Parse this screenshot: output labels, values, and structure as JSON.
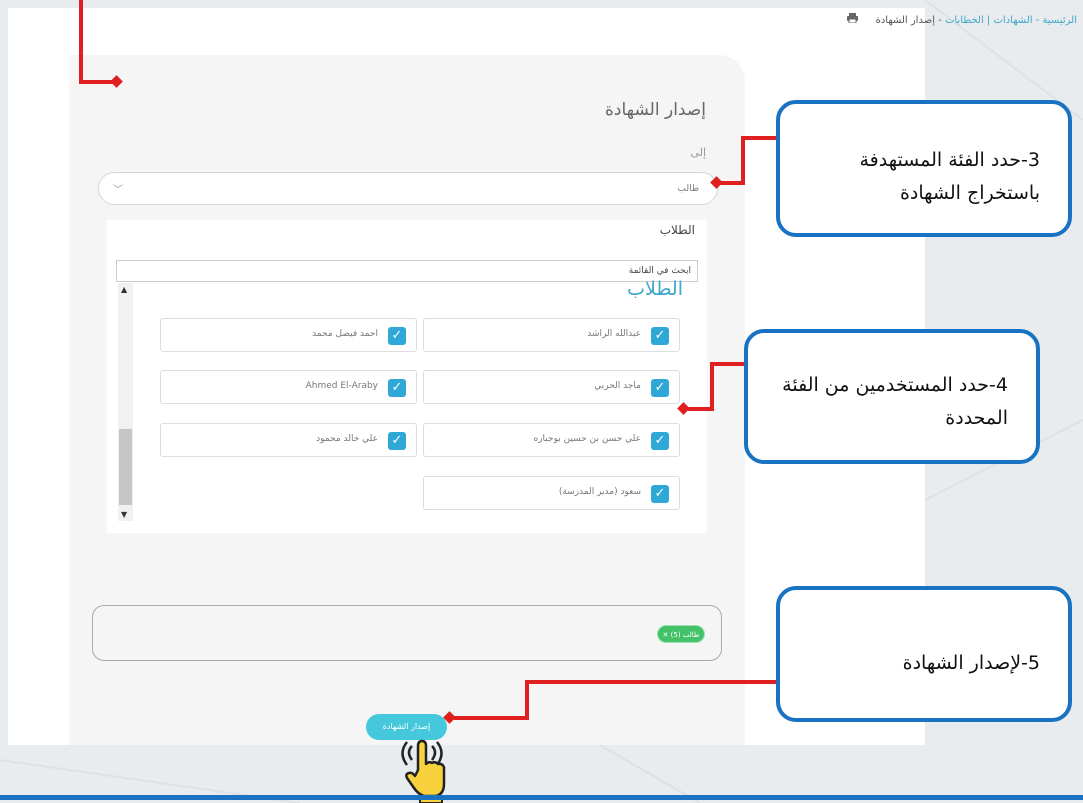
{
  "breadcrumb": {
    "home": "الرئيسية",
    "certificates": "الشهادات",
    "templates": "الخطابات",
    "current": "إصدار الشهادة"
  },
  "page_title": "إصدار الشهادة",
  "to_label": "إلى",
  "target_select": {
    "value": "طالب"
  },
  "students_card": {
    "header": "الطلاب",
    "search_placeholder": "ابحث في القائمة",
    "list_title": "الطلاب",
    "items": [
      {
        "name": "عبدالله الراشد",
        "checked": true
      },
      {
        "name": "احمد فيصل محمد",
        "checked": true
      },
      {
        "name": "ماجد الحربي",
        "checked": true
      },
      {
        "name": "Ahmed El-Araby",
        "checked": true
      },
      {
        "name": "علي حسن بن حسين بوجباره",
        "checked": true
      },
      {
        "name": "علي خالد محمود",
        "checked": true
      },
      {
        "name": "سعود (مدير المدرسة)",
        "checked": true
      }
    ]
  },
  "selected_tag": "طالب (5)",
  "issue_button": "إصدار الشهادة",
  "callouts": {
    "step3": "3-حدد الفئة المستهدفة باستخراج الشهادة",
    "step4": "4-حدد المستخدمين من الفئة المحددة",
    "step5": "5-لإصدار الشهادة"
  },
  "colors": {
    "accent": "#3ca7c8",
    "callout_border": "#1a73c2",
    "arrow": "#e02020",
    "tag": "#44c26a"
  }
}
